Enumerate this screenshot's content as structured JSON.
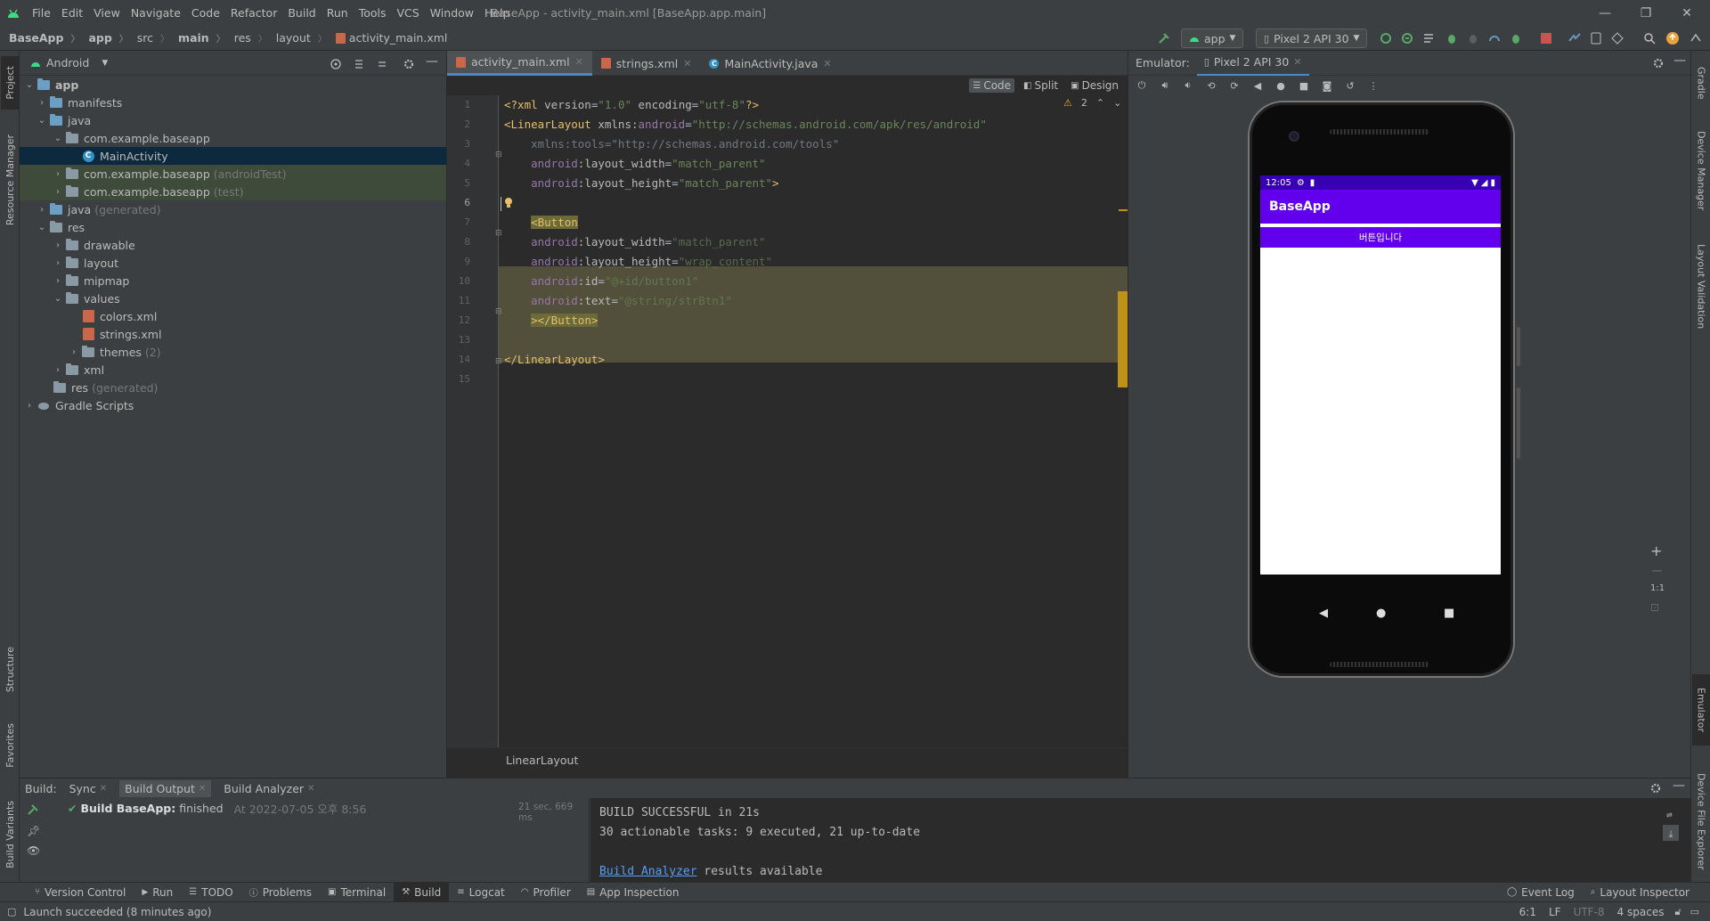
{
  "window": {
    "title": "BaseApp - activity_main.xml [BaseApp.app.main]"
  },
  "menu": [
    "File",
    "Edit",
    "View",
    "Navigate",
    "Code",
    "Refactor",
    "Build",
    "Run",
    "Tools",
    "VCS",
    "Window",
    "Help"
  ],
  "breadcrumb": [
    "BaseApp",
    "app",
    "src",
    "main",
    "res",
    "layout",
    "activity_main.xml"
  ],
  "toolbar": {
    "run_config": "app",
    "device": "Pixel 2 API 30"
  },
  "left_stripe": [
    "Project",
    "Resource Manager",
    "Structure",
    "Favorites",
    "Build Variants"
  ],
  "right_stripe": [
    "Gradle",
    "Device Manager",
    "Layout Validation",
    "Emulator",
    "Device File Explorer"
  ],
  "project": {
    "view_mode": "Android",
    "tree": [
      {
        "label": "app",
        "extra": ""
      },
      {
        "label": "manifests",
        "extra": ""
      },
      {
        "label": "java",
        "extra": ""
      },
      {
        "label": "com.example.baseapp",
        "extra": ""
      },
      {
        "label": "MainActivity",
        "extra": ""
      },
      {
        "label": "com.example.baseapp",
        "extra": "(androidTest)"
      },
      {
        "label": "com.example.baseapp",
        "extra": "(test)"
      },
      {
        "label": "java",
        "extra": "(generated)"
      },
      {
        "label": "res",
        "extra": ""
      },
      {
        "label": "drawable",
        "extra": ""
      },
      {
        "label": "layout",
        "extra": ""
      },
      {
        "label": "mipmap",
        "extra": ""
      },
      {
        "label": "values",
        "extra": ""
      },
      {
        "label": "colors.xml",
        "extra": ""
      },
      {
        "label": "strings.xml",
        "extra": ""
      },
      {
        "label": "themes",
        "extra": "(2)"
      },
      {
        "label": "xml",
        "extra": ""
      },
      {
        "label": "res",
        "extra": "(generated)"
      },
      {
        "label": "Gradle Scripts",
        "extra": ""
      }
    ]
  },
  "editor": {
    "tabs": [
      "activity_main.xml",
      "strings.xml",
      "MainActivity.java"
    ],
    "views": [
      "Code",
      "Split",
      "Design"
    ],
    "warnings": "2",
    "line_numbers": [
      "1",
      "2",
      "3",
      "4",
      "5",
      "6",
      "7",
      "8",
      "9",
      "10",
      "11",
      "12",
      "13",
      "14",
      "15"
    ],
    "code": {
      "l1": {
        "a": "<?xml ",
        "b": "version",
        "c": "=",
        "d": "\"1.0\"",
        "e": " encoding",
        "f": "=",
        "g": "\"utf-8\"",
        "h": "?>"
      },
      "l2": {
        "a": "<LinearLayout ",
        "b": "xmlns:",
        "c": "android",
        "d": "=",
        "e": "\"http://schemas.android.com/apk/res/android\""
      },
      "l3": {
        "a": "    xmlns:tools=\"http://schemas.android.com/tools\""
      },
      "l4": {
        "a": "    ",
        "b": "android",
        "c": ":layout_width",
        "d": "=",
        "e": "\"match_parent\""
      },
      "l5": {
        "a": "    ",
        "b": "android",
        "c": ":layout_height",
        "d": "=",
        "e": "\"match_parent\"",
        "f": ">"
      },
      "l7": {
        "a": "    ",
        "b": "<Button"
      },
      "l8": {
        "a": "    ",
        "b": "android",
        "c": ":layout_width",
        "d": "=",
        "e": "\"match_parent\""
      },
      "l9": {
        "a": "    ",
        "b": "android",
        "c": ":layout_height",
        "d": "=",
        "e": "\"wrap_content\""
      },
      "l10": {
        "a": "    ",
        "b": "android",
        "c": ":id",
        "d": "=",
        "e": "\"@+id/button1\""
      },
      "l11": {
        "a": "    ",
        "b": "android",
        "c": ":text",
        "d": "=",
        "e": "\"@string/strBtn1\""
      },
      "l12": {
        "a": "    ",
        "b": "></Button>"
      },
      "l15": {
        "a": "</LinearLayout>"
      }
    },
    "footer_breadcrumb": "LinearLayout"
  },
  "emulator": {
    "label": "Emulator:",
    "device_tab": "Pixel 2 API 30",
    "status_time": "12:05",
    "app_title": "BaseApp",
    "button_text": "버튼입니다",
    "zoom_ratio": "1:1"
  },
  "build": {
    "label": "Build:",
    "tabs": [
      "Sync",
      "Build Output",
      "Build Analyzer"
    ],
    "tree_item_bold": "Build BaseApp:",
    "tree_item_rest": " finished",
    "tree_item_time": "At 2022-07-05 오후 8:56",
    "duration": "21 sec, 669 ms",
    "output": {
      "line1": "BUILD SUCCESSFUL in 21s",
      "line2": "30 actionable tasks: 9 executed, 21 up-to-date",
      "link": "Build Analyzer",
      "link_rest": " results available"
    }
  },
  "bottom_tools": [
    "Version Control",
    "Run",
    "TODO",
    "Problems",
    "Terminal",
    "Build",
    "Logcat",
    "Profiler",
    "App Inspection"
  ],
  "bottom_right_tools": [
    "Event Log",
    "Layout Inspector"
  ],
  "status": {
    "message": "Launch succeeded (8 minutes ago)",
    "position": "6:1",
    "line_sep": "LF",
    "encoding": "UTF-8",
    "indent": "4 spaces"
  },
  "colors": {
    "accent": "#4a88c7",
    "app_primary": "#6200ee",
    "app_dark": "#3700b3"
  }
}
